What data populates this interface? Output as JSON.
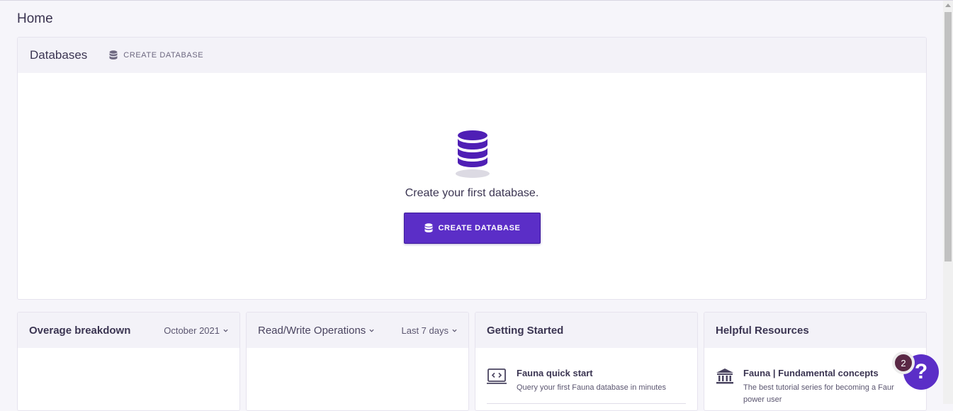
{
  "page": {
    "title": "Home"
  },
  "databases": {
    "title": "Databases",
    "header_action_label": "CREATE DATABASE",
    "empty_text": "Create your first database.",
    "primary_button_label": "CREATE DATABASE"
  },
  "panels": [
    {
      "title": "Overage breakdown",
      "dropdown": "October 2021"
    },
    {
      "title": "Read/Write Operations",
      "dropdown": "Last 7 days"
    },
    {
      "title": "Getting Started",
      "item": {
        "title": "Fauna quick start",
        "desc": "Query your first Fauna database in minutes"
      }
    },
    {
      "title": "Helpful Resources",
      "item": {
        "title": "Fauna | Fundamental concepts",
        "desc": "The best tutorial series for becoming a Faur power user"
      }
    }
  ],
  "help": {
    "label": "?",
    "badge_count": "2"
  },
  "icons": {
    "database": "database-icon",
    "chevron": "chevron-down-icon",
    "code": "code-window-icon",
    "bank": "bank-icon"
  },
  "colors": {
    "accent": "#5b2ec7",
    "badge": "#5a2845"
  }
}
